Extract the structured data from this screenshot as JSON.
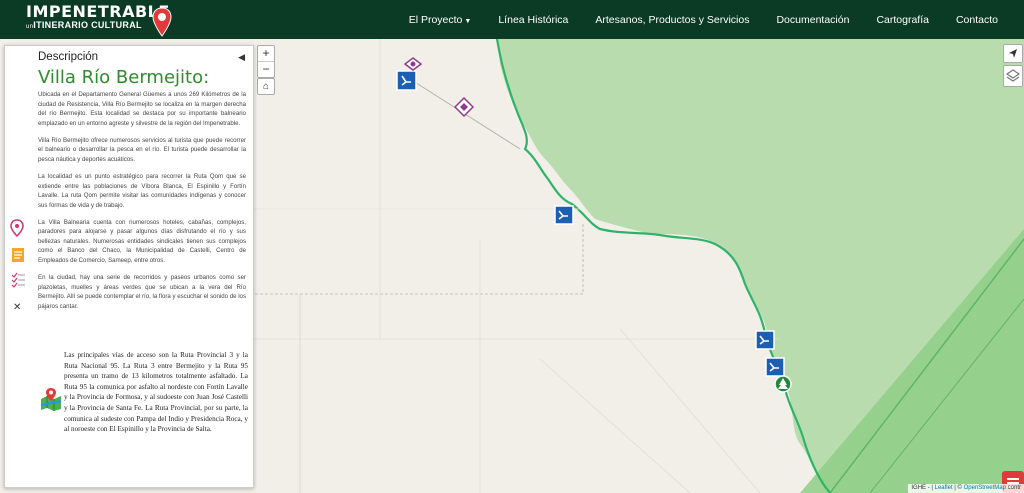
{
  "header": {
    "logo_main": "IMPENETRABLE",
    "logo_sub_prefix": "un",
    "logo_sub": "ITINERARIO CULTURAL",
    "nav": [
      {
        "label": "El Proyecto"
      },
      {
        "label": "Línea Histórica"
      },
      {
        "label": "Artesanos, Productos y Servicios"
      },
      {
        "label": "Documentación"
      },
      {
        "label": "Cartografía"
      },
      {
        "label": "Contacto"
      }
    ]
  },
  "panel": {
    "header": "Descripción",
    "collapse_icon": "◀",
    "title": "Villa Río Bermejito:",
    "paragraphs": [
      "Ubicada en el Departamento General Güemes a unos 269 Kilómetros de la ciudad de Resistencia, Villa Río Bermejito se localiza en la margen derecha del río Bermejito. Esta localidad se destaca por su importante balneario emplazado en un entorno agreste y silvestre de la región del Impenetrable.",
      "Villa Río Bermejito ofrece numerosos servicios al turista que puede recorrer el balneario o desarrollar la pesca en el río. El turista puede desarrollar la pesca náutica y deportes acuáticos.",
      "La localidad es un punto estratégico para recorrer la Ruta Qom que se extiende entre las poblaciones de Víbora Blanca, El Espinillo y Fortín Lavalle. La ruta Qom permite visitar las comunidades indígenas y conocer sus formas de vida y de trabajo.",
      "La Villa Balnearia cuenta con numerosos hoteles, cabañas, complejos, paradores para alojarse y pasar algunos días disfrutando el río y sus bellezas naturales. Numerosas entidades sindicales tienen sus complejos como el Banco del Chaco, la Municipalidad de Castelli, Centro de Empleados de Comercio, Sameep, entre otros.",
      "En la ciudad, hay una serie de recorridos y paseos urbanos como ser plazoletas, muelles y áreas verdes que se ubican a la vera del Río Bermejito. Allí se puede contemplar el río, la flora y escuchar el sonido de los pájaros cantar."
    ],
    "access_text": "Las principales vías de acceso son la Ruta Provincial 3 y la Ruta Nacional 95. La Ruta 3 entre Bermejito y la Ruta 95 presenta un tramo de 13 kilometros totalmente asfaltado. La Ruta 95 la comunica por asfalto al nordeste con Fortín Lavalle y la Provincia de Formosa, y al sudoeste con Juan José Castelli y la Provincia de Santa Fe. La Ruta Provincial, por su parte, la comunica al sudeste con Pampa del Indio y Presidencia Roca, y al noroeste con El Espinillo y la Provincia de Salta.",
    "close_icon": "✕"
  },
  "map_controls": {
    "zoom_in": "+",
    "zoom_out": "−",
    "home": "⌂"
  },
  "attribution": {
    "prefix": "IGHE - |",
    "leaflet": "Leaflet",
    "sep": "| ©",
    "osm": "OpenStreetMap",
    "suffix": "contr"
  },
  "colors": {
    "header_bg": "#0b3b24",
    "title_green": "#2e8b2e",
    "park_green": "#b9dcae",
    "river_green": "#2fb36a",
    "marker_blue": "#1a5fb4",
    "marker_purple": "#8e3a8e"
  }
}
